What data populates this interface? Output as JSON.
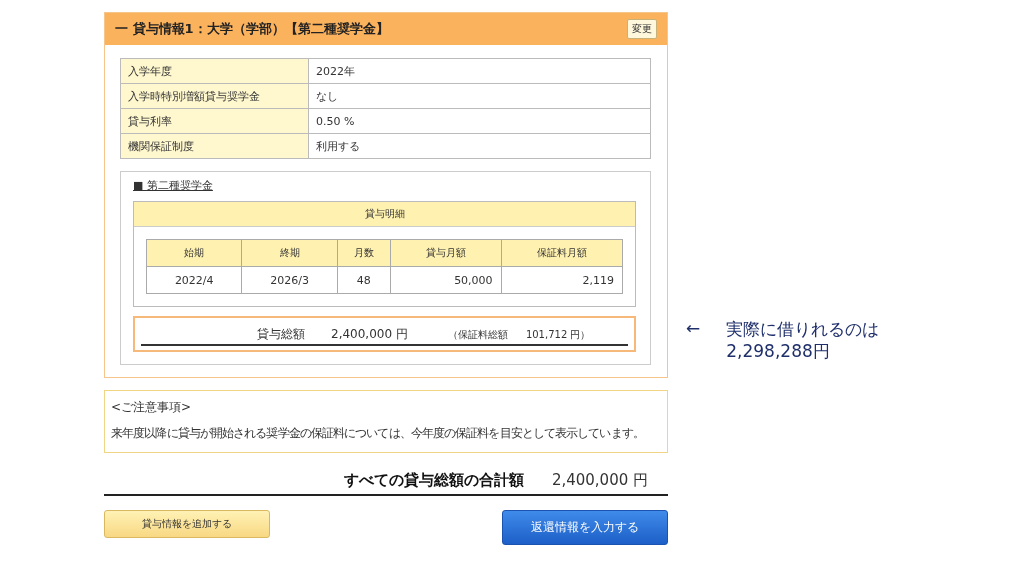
{
  "loan_panel": {
    "title": "一 貸与情報1：大学（学部）【第二種奨学金】",
    "change_button": "変更",
    "info_rows": [
      {
        "label": "入学年度",
        "value": "2022年"
      },
      {
        "label": "入学時特別増額貸与奨学金",
        "value": "なし"
      },
      {
        "label": "貸与利率",
        "value": "0.50 %"
      },
      {
        "label": "機関保証制度",
        "value": "利用する"
      }
    ],
    "section_heading": "■ 第二種奨学金",
    "detail": {
      "title": "貸与明細",
      "columns": [
        "始期",
        "終期",
        "月数",
        "貸与月額",
        "保証料月額"
      ],
      "rows": [
        [
          "2022/4",
          "2026/3",
          "48",
          "50,000",
          "2,119"
        ]
      ]
    },
    "total": {
      "label": "貸与総額",
      "amount": "2,400,000 円",
      "fee_label": "（保証料総額",
      "fee_amount": "101,712 円）"
    }
  },
  "notes": {
    "title": "<ご注意事項>",
    "text": "来年度以降に貸与が開始される奨学金の保証料については、今年度の保証料を目安として表示しています。"
  },
  "grand_total": {
    "label": "すべての貸与総額の合計額",
    "amount": "2,400,000 円"
  },
  "buttons": [
    {
      "label": "貸与情報を追加する",
      "kind": "secondary"
    },
    {
      "label": "返還情報を入力する",
      "kind": "primary"
    }
  ],
  "annotation": {
    "arrow": "←",
    "lines": [
      "実際に借りれるのは",
      "2,298,288円"
    ]
  }
}
